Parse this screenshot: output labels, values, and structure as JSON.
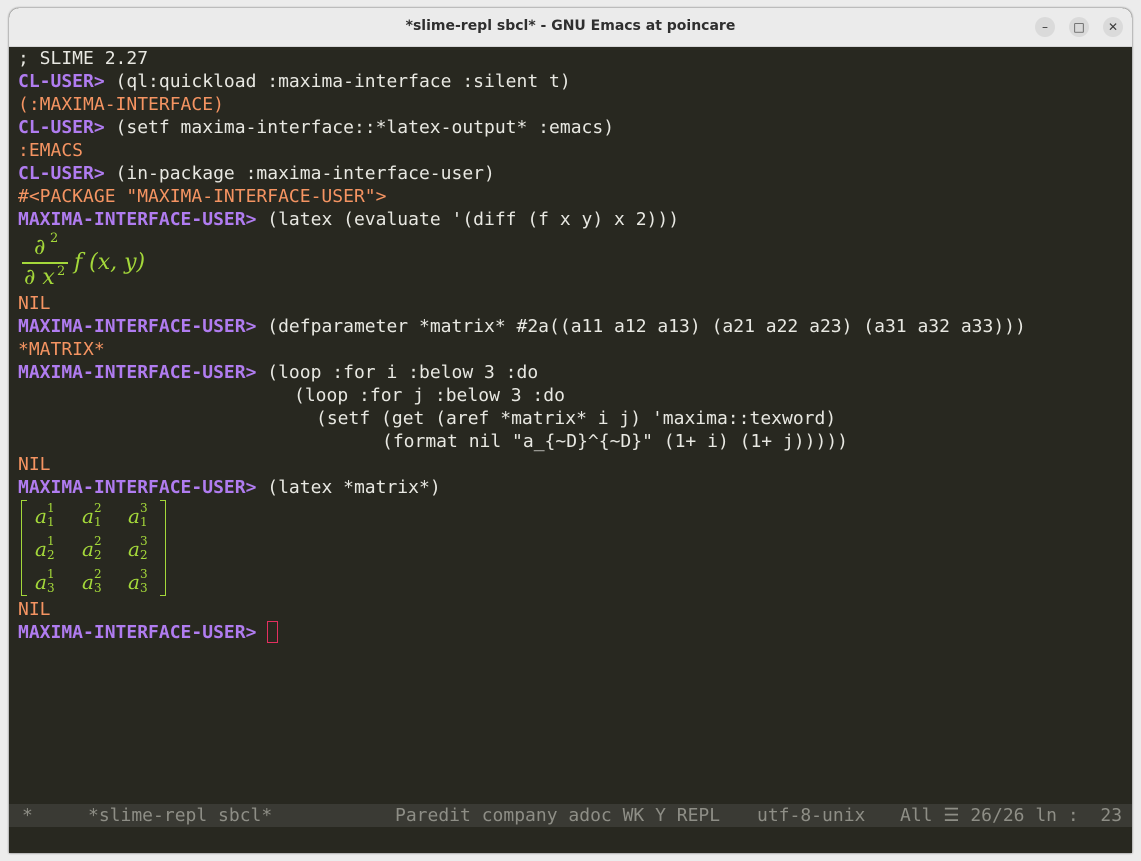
{
  "window": {
    "title": "*slime-repl sbcl* - GNU Emacs at poincare",
    "controls": {
      "minimize": "–",
      "maximize": "□",
      "close": "✕"
    }
  },
  "repl": {
    "banner": "; SLIME 2.27",
    "prompt_cl": "CL-USER>",
    "prompt_mi": "MAXIMA-INTERFACE-USER>",
    "cmd1": " (ql:quickload :maxima-interface :silent t)",
    "out1": "(:MAXIMA-INTERFACE)",
    "cmd2": " (setf maxima-interface::*latex-output* :emacs)",
    "out2": ":EMACS",
    "cmd3": " (in-package :maxima-interface-user)",
    "out3": "#<PACKAGE \"MAXIMA-INTERFACE-USER\">",
    "cmd4": " (latex (evaluate '(diff (f x y) x 2)))",
    "math1": {
      "numerator": "∂",
      "numerator_exp": "2",
      "denominator": "∂ x",
      "denominator_exp": "2",
      "function": "f (x, y)"
    },
    "out4": "NIL",
    "cmd5": " (defparameter *matrix* #2a((a11 a12 a13) (a21 a22 a23) (a31 a32 a33)))",
    "out5": "*MATRIX*",
    "cmd6_1": " (loop :for i :below 3 :do",
    "cmd6_2": "(loop :for j :below 3 :do",
    "cmd6_3": "(setf (get (aref *matrix* i j) 'maxima::texword)",
    "cmd6_4": "(format nil \"a_{~D}^{~D}\" (1+ i) (1+ j)))))",
    "out6": "NIL",
    "cmd7": " (latex *matrix*)",
    "matrix": {
      "base": "a",
      "rows": [
        [
          {
            "sub": "1",
            "sup": "1"
          },
          {
            "sub": "1",
            "sup": "2"
          },
          {
            "sub": "1",
            "sup": "3"
          }
        ],
        [
          {
            "sub": "2",
            "sup": "1"
          },
          {
            "sub": "2",
            "sup": "2"
          },
          {
            "sub": "2",
            "sup": "3"
          }
        ],
        [
          {
            "sub": "3",
            "sup": "1"
          },
          {
            "sub": "3",
            "sup": "2"
          },
          {
            "sub": "3",
            "sup": "3"
          }
        ]
      ]
    },
    "out7": "NIL"
  },
  "modeline": {
    "modified": "*",
    "buffer": "*slime-repl sbcl*",
    "modes": "Paredit company adoc WK Y REPL",
    "encoding": "utf-8-unix",
    "position": "All ☰ 26/26 ln :  23"
  },
  "colors": {
    "background": "#282820",
    "prompt": "#b07cf0",
    "output": "#f59462",
    "math": "#a4d83a",
    "cursor": "#e3305f"
  }
}
